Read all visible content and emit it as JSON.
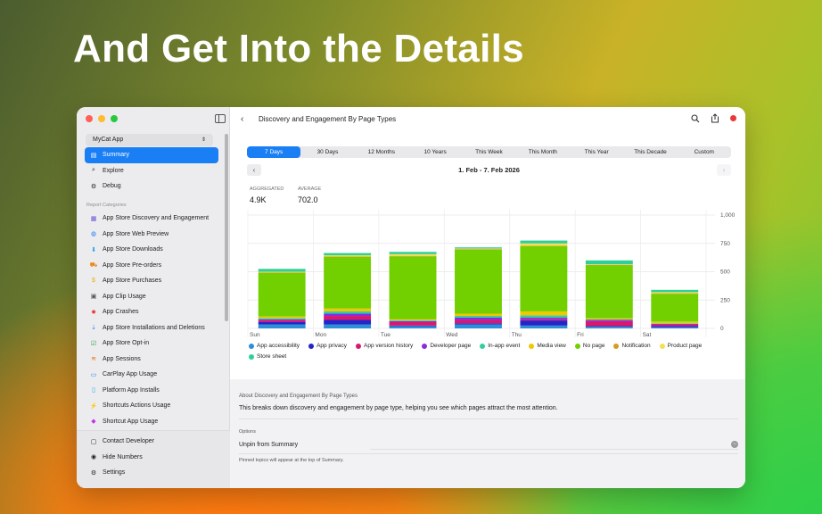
{
  "headline": "And Get Into the Details",
  "colors": {
    "accent": "#1a7ff5",
    "close": "#ff5f57",
    "minimize": "#febc2e",
    "zoom": "#28c840"
  },
  "sidebar": {
    "app_select": "MyCat App",
    "top_items": [
      {
        "label": "Summary",
        "icon": "doc-icon"
      },
      {
        "label": "Explore",
        "icon": "search-icon"
      },
      {
        "label": "Debug",
        "icon": "debug-icon"
      }
    ],
    "section_label": "Report Categories",
    "categories": [
      {
        "label": "App Store Discovery and Engagement",
        "icon": "grid-icon",
        "color": "#6b4fd8"
      },
      {
        "label": "App Store Web Preview",
        "icon": "globe-icon",
        "color": "#1a7ff5"
      },
      {
        "label": "App Store Downloads",
        "icon": "download-icon",
        "color": "#1aa0e8"
      },
      {
        "label": "App Store Pre-orders",
        "icon": "cart-icon",
        "color": "#e88a1a"
      },
      {
        "label": "App Store Purchases",
        "icon": "dollar-icon",
        "color": "#e8b01a"
      },
      {
        "label": "App Clip Usage",
        "icon": "clip-icon",
        "color": "#555555"
      },
      {
        "label": "App Crashes",
        "icon": "crash-icon",
        "color": "#e83a3a"
      },
      {
        "label": "App Store Installations and Deletions",
        "icon": "install-icon",
        "color": "#1a7ff5"
      },
      {
        "label": "App Store Opt-in",
        "icon": "check-icon",
        "color": "#28a745"
      },
      {
        "label": "App Sessions",
        "icon": "sessions-icon",
        "color": "#e8731a"
      },
      {
        "label": "CarPlay App Usage",
        "icon": "car-icon",
        "color": "#1a7ff5"
      },
      {
        "label": "Platform App Installs",
        "icon": "device-icon",
        "color": "#1aa0e8"
      },
      {
        "label": "Shortcuts Actions Usage",
        "icon": "shortcuts-icon",
        "color": "#e8359a"
      },
      {
        "label": "Shortcut App Usage",
        "icon": "shortcut-app-icon",
        "color": "#c235e8"
      }
    ],
    "bottom_items": [
      {
        "label": "Contact Developer",
        "icon": "chat-icon"
      },
      {
        "label": "Hide Numbers",
        "icon": "eye-icon"
      },
      {
        "label": "Settings",
        "icon": "gear-icon"
      }
    ]
  },
  "main": {
    "title": "Discovery and Engagement By Page Types",
    "ranges": [
      "7 Days",
      "30 Days",
      "12 Months",
      "10 Years",
      "This Week",
      "This Month",
      "This Year",
      "This Decade",
      "Custom"
    ],
    "active_range": "7 Days",
    "date_range": "1. Feb - 7. Feb 2026",
    "stats": [
      {
        "label": "AGGREGATED",
        "value": "4.9K"
      },
      {
        "label": "AVERAGE",
        "value": "702.0"
      }
    ],
    "about_heading": "About Discovery and Engagement By Page Types",
    "about_text": "This breaks down discovery and engagement by page type, helping you see which pages attract the most attention.",
    "options_heading": "Options",
    "options_row": "Unpin from Summary",
    "options_note": "Pinned topics will appear at the top of Summary."
  },
  "chart_data": {
    "type": "bar",
    "stacked": true,
    "categories": [
      "Sun",
      "Mon",
      "Tue",
      "Wed",
      "Thu",
      "Fri",
      "Sat"
    ],
    "ylim": [
      0,
      1000
    ],
    "yticks": [
      0,
      250,
      500,
      750,
      1000
    ],
    "ytick_labels": [
      "0",
      "250",
      "500",
      "750",
      "1,000"
    ],
    "grid": true,
    "legend_position": "bottom",
    "series": [
      {
        "name": "App accessibility",
        "color": "#2e8fd8",
        "values": [
          35,
          35,
          20,
          35,
          25,
          15,
          10
        ]
      },
      {
        "name": "App privacy",
        "color": "#2424c8",
        "values": [
          20,
          40,
          5,
          10,
          45,
          5,
          10
        ]
      },
      {
        "name": "App version history",
        "color": "#d8186e",
        "values": [
          15,
          35,
          30,
          30,
          10,
          45,
          15
        ]
      },
      {
        "name": "Developer page",
        "color": "#8a2be2",
        "values": [
          10,
          20,
          10,
          20,
          15,
          10,
          5
        ]
      },
      {
        "name": "In-app event",
        "color": "#2fd0a0",
        "values": [
          10,
          20,
          5,
          15,
          20,
          5,
          5
        ]
      },
      {
        "name": "Media view",
        "color": "#f0c800",
        "values": [
          15,
          25,
          10,
          20,
          35,
          10,
          15
        ]
      },
      {
        "name": "No page",
        "color": "#72d000",
        "values": [
          385,
          455,
          555,
          565,
          575,
          465,
          245
        ]
      },
      {
        "name": "Notification",
        "color": "#d89a20",
        "values": [
          5,
          5,
          5,
          5,
          5,
          5,
          5
        ]
      },
      {
        "name": "Product page",
        "color": "#f5e050",
        "values": [
          5,
          10,
          15,
          5,
          20,
          5,
          10
        ]
      },
      {
        "name": "Store sheet",
        "color": "#2fcf9a",
        "values": [
          25,
          20,
          20,
          10,
          25,
          35,
          20
        ]
      }
    ]
  }
}
